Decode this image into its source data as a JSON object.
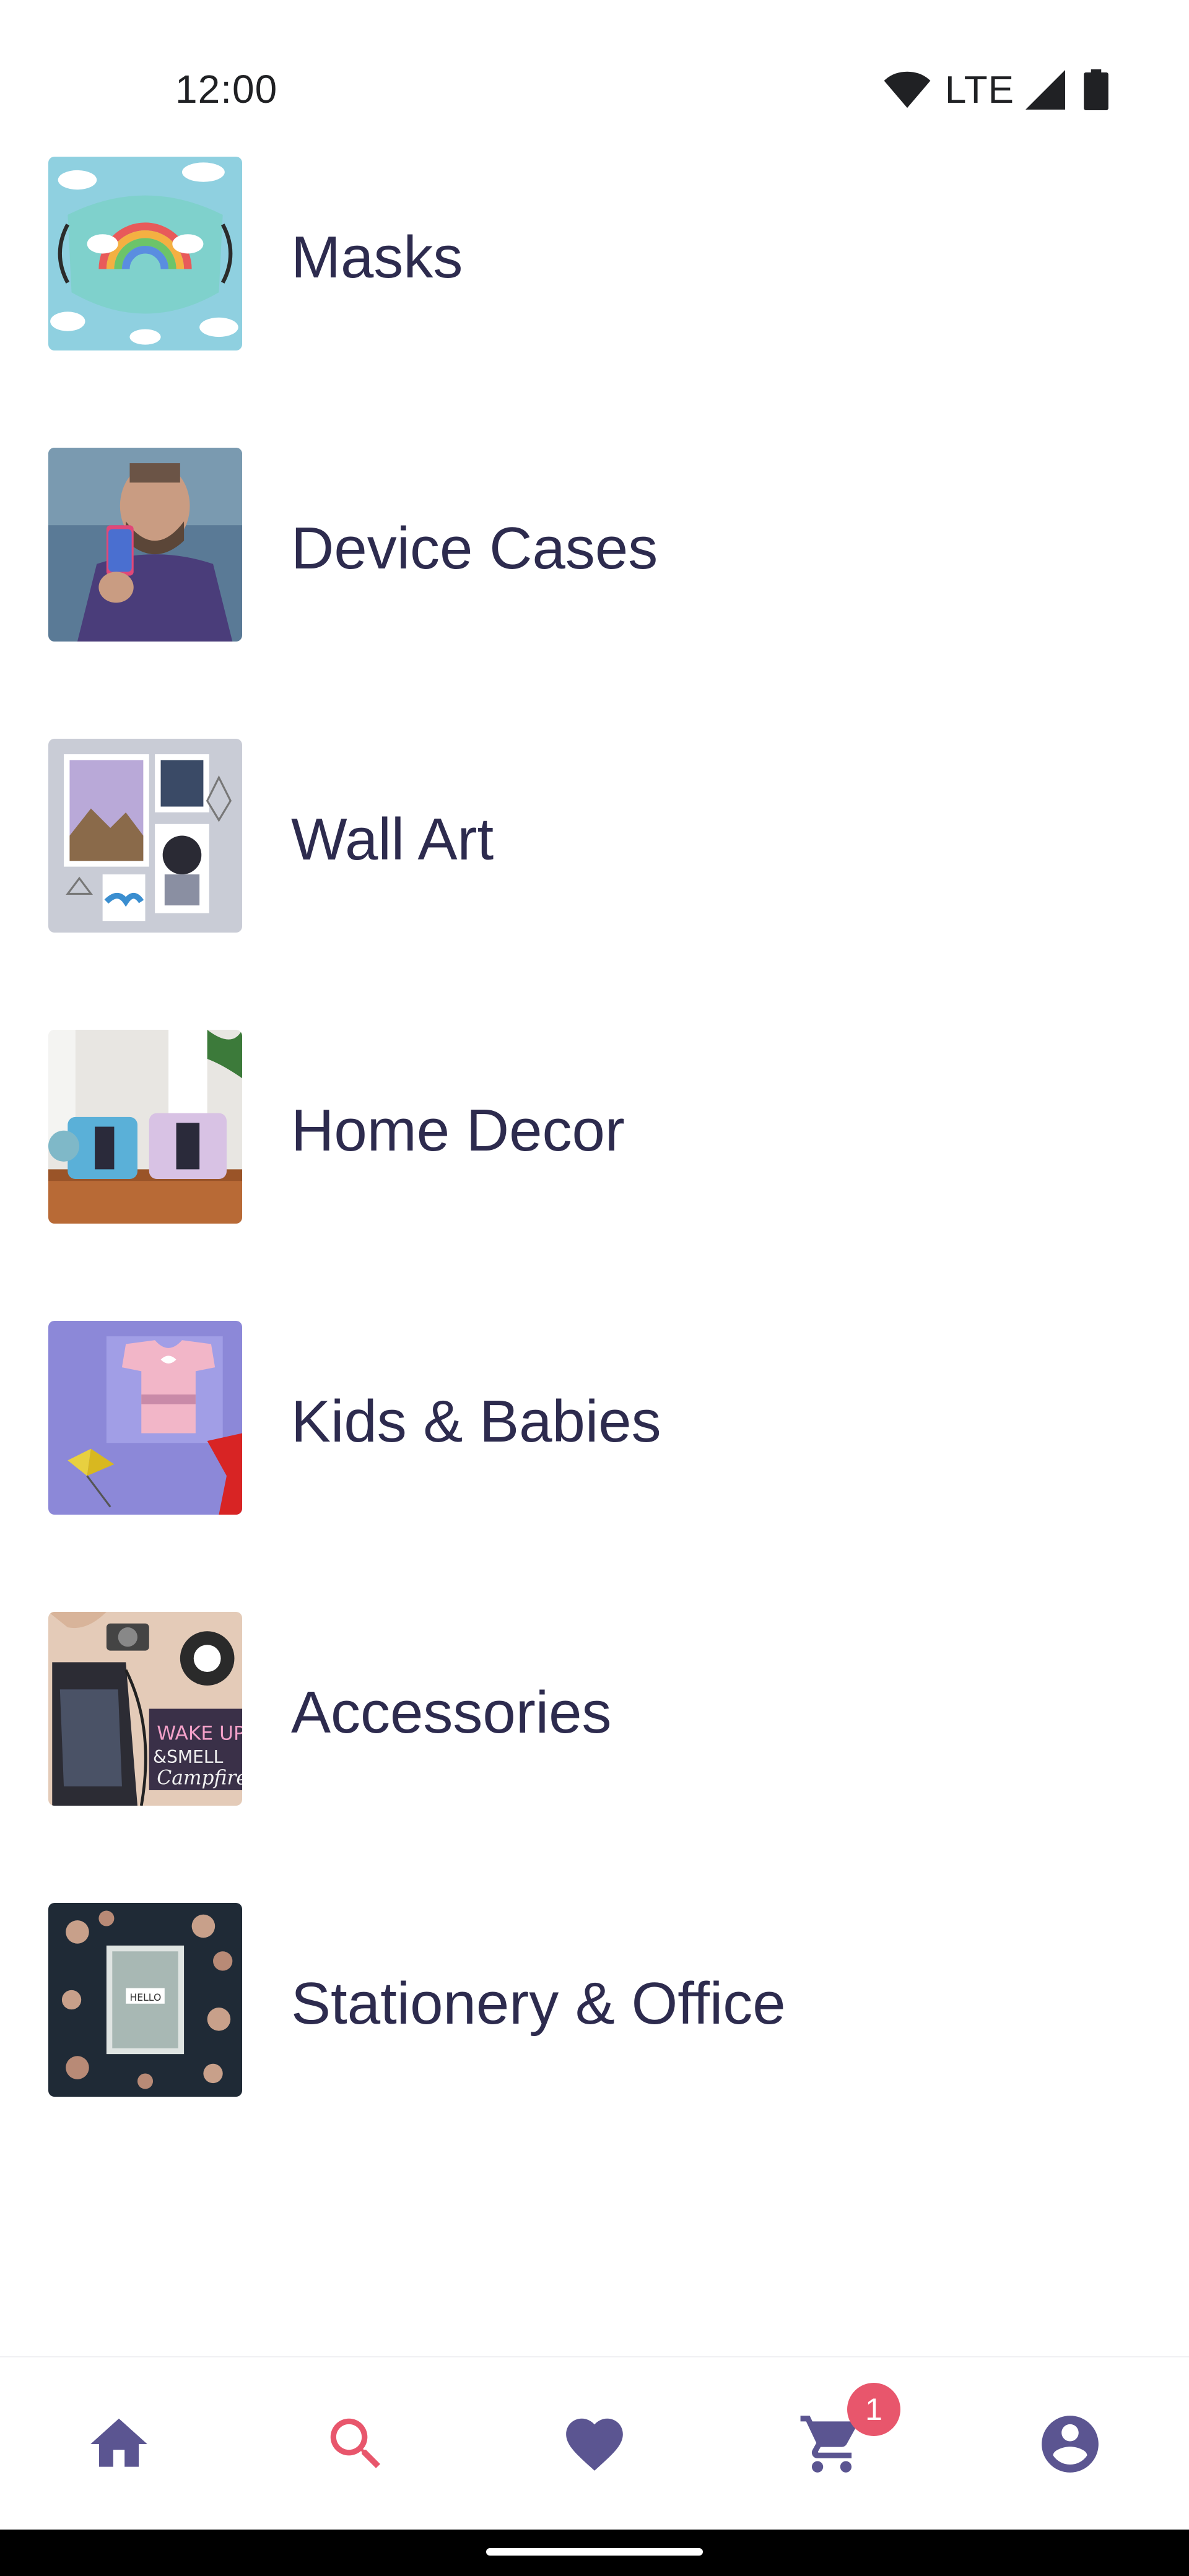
{
  "status_bar": {
    "time": "12:00",
    "network": "LTE",
    "icons": [
      "wifi-icon",
      "signal-icon",
      "battery-icon"
    ]
  },
  "categories": [
    {
      "label": "Masks",
      "image": "masks-thumbnail"
    },
    {
      "label": "Device Cases",
      "image": "device-cases-thumbnail"
    },
    {
      "label": "Wall Art",
      "image": "wall-art-thumbnail"
    },
    {
      "label": "Home Decor",
      "image": "home-decor-thumbnail"
    },
    {
      "label": "Kids & Babies",
      "image": "kids-babies-thumbnail"
    },
    {
      "label": "Accessories",
      "image": "accessories-thumbnail"
    },
    {
      "label": "Stationery & Office",
      "image": "stationery-office-thumbnail"
    }
  ],
  "bottom_nav": {
    "items": [
      {
        "icon": "home-icon",
        "active": false
      },
      {
        "icon": "search-icon",
        "active": true
      },
      {
        "icon": "heart-icon",
        "active": false
      },
      {
        "icon": "cart-icon",
        "active": false
      },
      {
        "icon": "account-icon",
        "active": false
      }
    ],
    "cart_badge": "1"
  },
  "colors": {
    "label_text": "#2d2b4e",
    "nav_icon": "#5b5591",
    "nav_active": "#e8566c",
    "badge": "#e8566c"
  }
}
